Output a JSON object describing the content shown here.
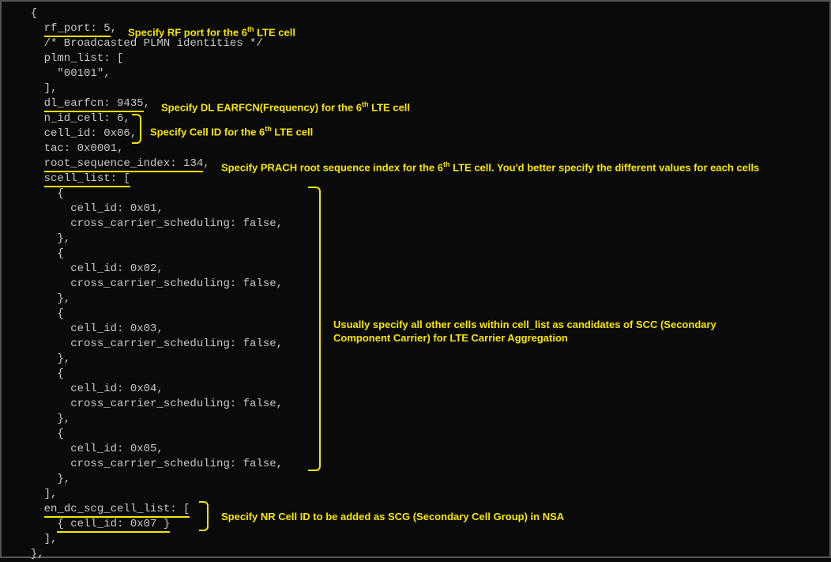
{
  "code": {
    "l1": "  {",
    "l2_a": "    ",
    "l2_b": "rf_port: 5",
    "l2_c": ",",
    "l3": "    /* Broadcasted PLMN identities */",
    "l4": "    plmn_list: [",
    "l5": "      \"00101\",",
    "l6": "    ],",
    "l7_a": "    ",
    "l7_b": "dl_earfcn: 9435",
    "l7_c": ",",
    "l8": "    n_id_cell: 6,",
    "l9": "    cell_id: 0x06,",
    "l10": "    tac: 0x0001,",
    "l11_a": "    ",
    "l11_b": "root_sequence_index: 134",
    "l11_c": ",",
    "l12_a": "    ",
    "l12_b": "scell_list: [",
    "l13": "      {",
    "l14": "        cell_id: 0x01,",
    "l15": "        cross_carrier_scheduling: false,",
    "l16": "      },",
    "l17": "      {",
    "l18": "        cell_id: 0x02,",
    "l19": "        cross_carrier_scheduling: false,",
    "l20": "      },",
    "l21": "      {",
    "l22": "        cell_id: 0x03,",
    "l23": "        cross_carrier_scheduling: false,",
    "l24": "      },",
    "l25": "      {",
    "l26": "        cell_id: 0x04,",
    "l27": "        cross_carrier_scheduling: false,",
    "l28": "      },",
    "l29": "      {",
    "l30": "        cell_id: 0x05,",
    "l31": "        cross_carrier_scheduling: false,",
    "l32": "      },",
    "l33": "    ],",
    "l34_a": "    ",
    "l34_b": "en_dc_scg_cell_list: [",
    "l35_a": "      ",
    "l35_b": "{ cell_id: 0x07 }",
    "l36": "    ],",
    "l37": "  },"
  },
  "annotations": {
    "rf_port": "Specify RF port for the 6<sup>th</sup> LTE cell",
    "dl_earfcn": "Specify DL EARFCN(Frequency) for the 6<sup>th</sup> LTE cell",
    "cell_id": "Specify Cell ID for the 6<sup>th</sup> LTE cell",
    "root_seq": "Specify PRACH root sequence index for the 6<sup>th</sup> LTE cell. You'd better specify the different values for each cells",
    "scell": "Usually specify all other cells within cell_list as candidates of SCC (Secondary Component Carrier) for LTE Carrier Aggregation",
    "scg": "Specify NR Cell ID to be added as SCG (Secondary Cell Group) in NSA"
  }
}
